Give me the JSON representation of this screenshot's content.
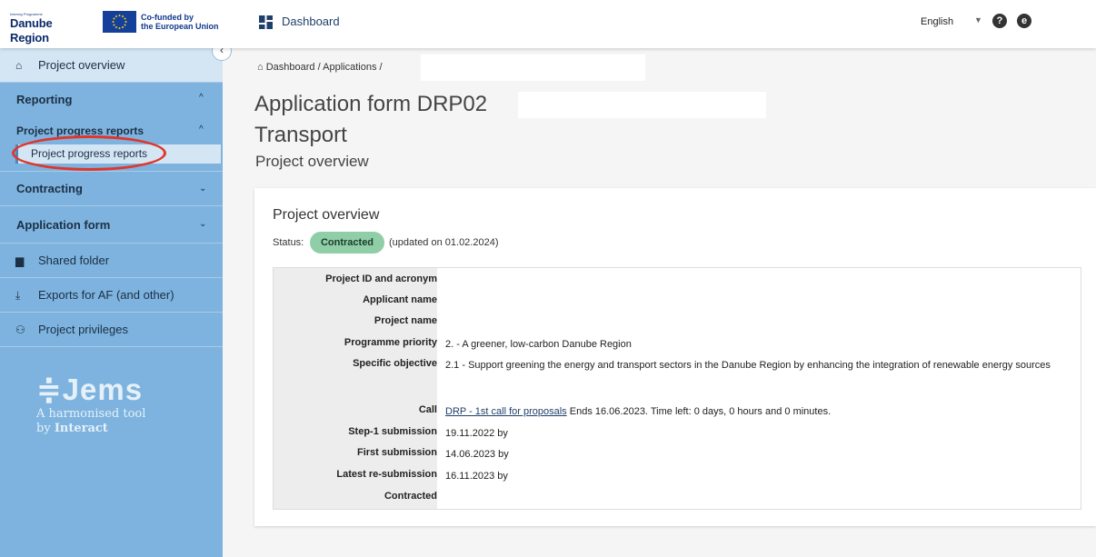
{
  "header": {
    "brand_small": "Interreg Programme",
    "brand_name": "Danube Region",
    "cofunded_line1": "Co-funded by",
    "cofunded_line2": "the European Union",
    "dashboard_label": "Dashboard",
    "language": "English"
  },
  "sidebar": {
    "project_overview": "Project overview",
    "reporting": "Reporting",
    "project_progress_reports": "Project progress reports",
    "project_progress_reports_item": "Project progress reports",
    "contracting": "Contracting",
    "application_form": "Application form",
    "shared_folder": "Shared folder",
    "exports": "Exports for AF (and other)",
    "privileges": "Project privileges",
    "jems_logo": "Jems",
    "jems_tag1": "A harmonised tool",
    "jems_tag2_by": "by",
    "jems_tag2_brand": "Interact"
  },
  "breadcrumb": {
    "home": "Dashboard",
    "sep1": "/",
    "applications": "Applications",
    "sep2": "/"
  },
  "page": {
    "title_line1": "Application form DRP02",
    "title_line2": "Transport",
    "subtitle": "Project overview"
  },
  "card": {
    "title": "Project overview",
    "status_label": "Status:",
    "status_value": "Contracted",
    "status_updated": "(updated on 01.02.2024)",
    "rows": [
      {
        "key": "Project ID and acronym",
        "value": ""
      },
      {
        "key": "Applicant name",
        "value": ""
      },
      {
        "key": "Project name",
        "value": ""
      },
      {
        "key": "Programme priority",
        "value": "2. - A greener, low-carbon Danube Region"
      },
      {
        "key": "Specific objective",
        "value": "2.1 - Support greening the energy and transport sectors in the Danube Region by enhancing the integration of renewable energy sources"
      },
      {
        "key": "Call",
        "link": "DRP - 1st call for proposals",
        "value": "Ends 16.06.2023. Time left: 0 days, 0 hours and 0 minutes."
      },
      {
        "key": "Step-1 submission",
        "value": "19.11.2022 by"
      },
      {
        "key": "First submission",
        "value": "14.06.2023 by"
      },
      {
        "key": "Latest re-submission",
        "value": "16.11.2023 by"
      },
      {
        "key": "Contracted",
        "value": ""
      }
    ]
  },
  "colors": {
    "sidebar_bg": "#7db3de",
    "status_badge": "#8fcea6",
    "annotation_circle": "#e0362b"
  }
}
